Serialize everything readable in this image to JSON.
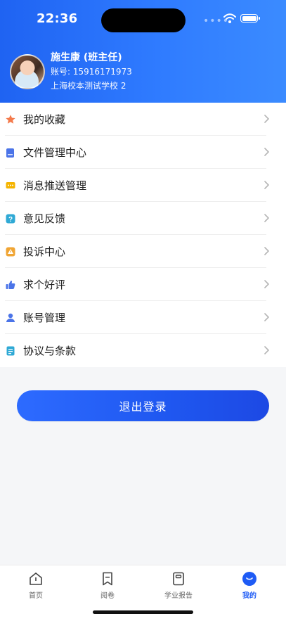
{
  "status_bar": {
    "time": "22:36"
  },
  "profile": {
    "name": "施生康 (班主任)",
    "account": "账号: 15916171973",
    "school": "上海校本测试学校 2"
  },
  "menu": [
    {
      "label": "我的收藏",
      "icon": "star-icon",
      "color": "#f47a4b"
    },
    {
      "label": "文件管理中心",
      "icon": "folder-icon",
      "color": "#4b74e8"
    },
    {
      "label": "消息推送管理",
      "icon": "message-icon",
      "color": "#f5b400"
    },
    {
      "label": "意见反馈",
      "icon": "question-icon",
      "color": "#2fa9d5"
    },
    {
      "label": "投诉中心",
      "icon": "warning-icon",
      "color": "#f0a534"
    },
    {
      "label": "求个好评",
      "icon": "thumbs-up-icon",
      "color": "#4b74e8"
    },
    {
      "label": "账号管理",
      "icon": "user-icon",
      "color": "#4b74e8"
    },
    {
      "label": "协议与条款",
      "icon": "document-icon",
      "color": "#2fa9d5"
    }
  ],
  "logout": {
    "label": "退出登录"
  },
  "tabs": [
    {
      "label": "首页",
      "icon": "home-icon"
    },
    {
      "label": "阅卷",
      "icon": "bookmark-icon"
    },
    {
      "label": "学业报告",
      "icon": "report-icon"
    },
    {
      "label": "我的",
      "icon": "profile-icon",
      "active": true
    }
  ],
  "colors": {
    "accent": "#1e5bf5",
    "header_start": "#1f63f2",
    "header_end": "#3b8bff"
  }
}
